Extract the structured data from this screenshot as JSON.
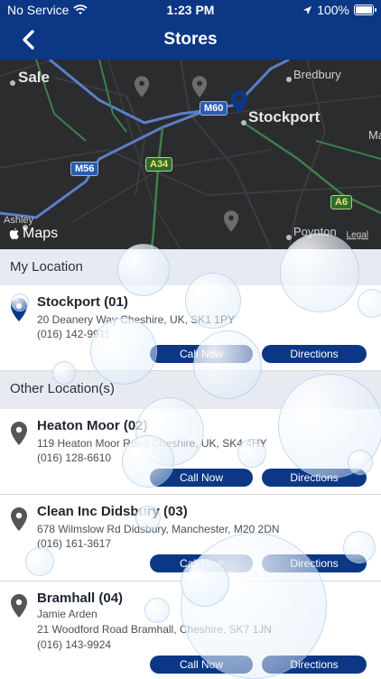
{
  "status": {
    "carrier": "No Service",
    "time": "1:23 PM",
    "battery": "100%"
  },
  "nav": {
    "title": "Stores"
  },
  "map": {
    "labels": {
      "sale": "Sale",
      "bredbury": "Bredbury",
      "stockport": "Stockport",
      "ma": "Ma",
      "ashley": "Ashley",
      "poynton": "Poynton"
    },
    "roads": {
      "m60": "M60",
      "m56": "M56",
      "a34": "A34",
      "a6": "A6"
    },
    "brand": "Maps",
    "legal": "Legal"
  },
  "my_location": {
    "header": "My Location",
    "store": {
      "name": "Stockport (01)",
      "address": "20 Deanery Way Cheshire, UK, SK1 1PY",
      "phone": "(016) 142-9911",
      "call": "Call Now",
      "directions": "Directions"
    }
  },
  "other_locations": {
    "header": "Other Location(s)",
    "stores": [
      {
        "name": "Heaton Moor (02)",
        "address": "119 Heaton Moor Road Cheshire, UK, SK4 4HY",
        "phone": "(016) 128-6610",
        "call": "Call Now",
        "directions": "Directions"
      },
      {
        "name": "Clean Inc Didsbury (03)",
        "address": "678 Wilmslow Rd Didsbury, Manchester, M20 2DN",
        "phone": "(016) 161-3617",
        "call": "Call Now",
        "directions": "Directions"
      },
      {
        "name": "Bramhall (04)",
        "contact": "Jamie Arden",
        "address": "21 Woodford Road Bramhall, Cheshire, SK7 1JN",
        "phone": "(016) 143-9924",
        "call": "Call Now",
        "directions": "Directions"
      }
    ]
  },
  "colors": {
    "header": "#0b3785",
    "button": "#0b3785",
    "section_bg": "#e7eaf1",
    "pin_selected": "#0b3785",
    "pin_other": "#555555"
  }
}
